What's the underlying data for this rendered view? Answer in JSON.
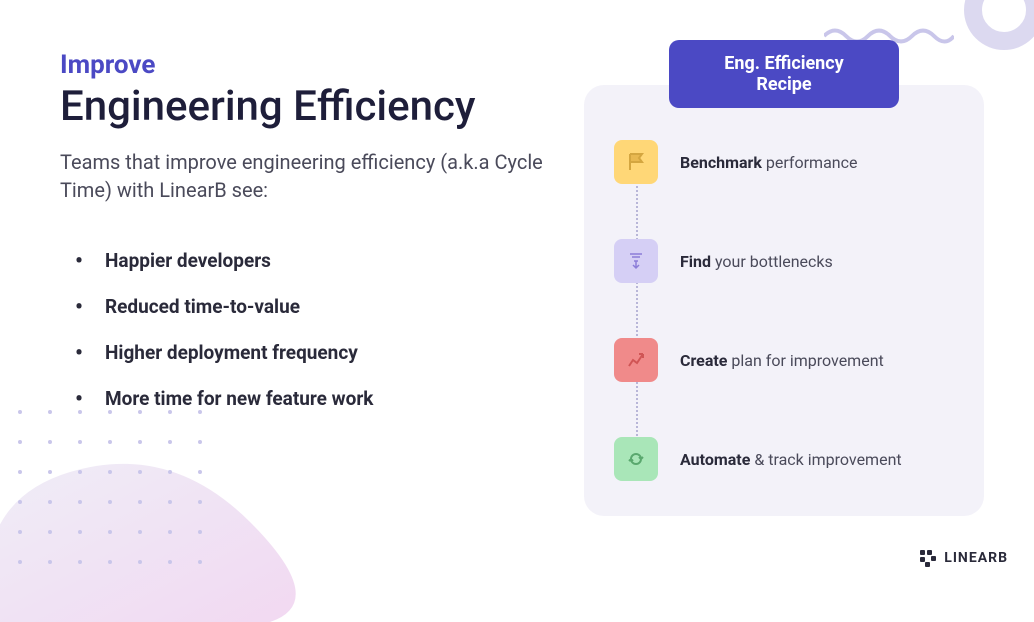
{
  "smallTitle": "Improve",
  "bigTitle": "Engineering Efficiency",
  "description": "Teams that improve engineering efficiency (a.k.a Cycle Time) with LinearB see:",
  "bullets": [
    "Happier developers",
    "Reduced time-to-value",
    "Higher deployment frequency",
    "More time for new feature work"
  ],
  "recipeHeader": "Eng. Efficiency Recipe",
  "steps": [
    {
      "bold": "Benchmark",
      "rest": " performance",
      "iconClass": "icon-yellow",
      "icon": "flag"
    },
    {
      "bold": "Find",
      "rest": " your bottlenecks",
      "iconClass": "icon-purple",
      "icon": "bottleneck"
    },
    {
      "bold": "Create",
      "rest": " plan for improvement",
      "iconClass": "icon-red",
      "icon": "chart"
    },
    {
      "bold": "Automate",
      "rest": " & track improvement",
      "iconClass": "icon-green",
      "icon": "refresh"
    }
  ],
  "logo": "LINEARB"
}
